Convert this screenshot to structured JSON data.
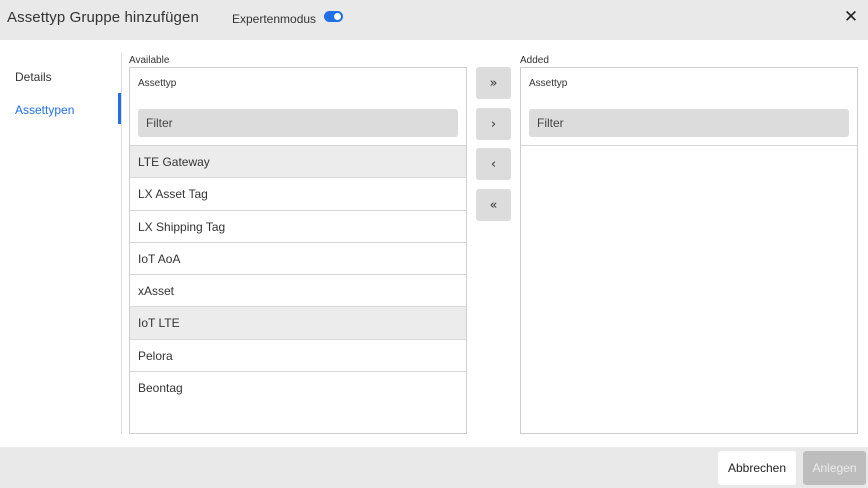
{
  "dialog": {
    "title": "Assettyp Gruppe hinzufügen",
    "expert_mode_label": "Expertenmodus",
    "expert_mode_on": true,
    "close_symbol": "✕"
  },
  "nav": {
    "items": [
      {
        "label": "Details",
        "active": false
      },
      {
        "label": "Assettypen",
        "active": true
      }
    ]
  },
  "available": {
    "label": "Available",
    "column_header": "Assettyp",
    "filter_placeholder": "Filter",
    "items": [
      {
        "label": "LTE Gateway",
        "shaded": true
      },
      {
        "label": "LX Asset Tag",
        "shaded": false
      },
      {
        "label": "LX Shipping Tag",
        "shaded": false
      },
      {
        "label": "IoT AoA",
        "shaded": false
      },
      {
        "label": "xAsset",
        "shaded": false
      },
      {
        "label": "IoT LTE",
        "shaded": true
      },
      {
        "label": "Pelora",
        "shaded": false
      },
      {
        "label": "Beontag",
        "shaded": false
      }
    ]
  },
  "added": {
    "label": "Added",
    "column_header": "Assettyp",
    "filter_placeholder": "Filter",
    "items": []
  },
  "transfer": {
    "move_all_right": "»",
    "move_right": "›",
    "move_left": "‹",
    "move_all_left": "«"
  },
  "footer": {
    "cancel_label": "Abbrechen",
    "create_label": "Anlegen",
    "create_disabled": true
  },
  "colors": {
    "accent": "#1f6fe5",
    "header_bg": "#e9e9e9",
    "button_gray": "#dcdcdc",
    "disabled_button": "#bdbdbd"
  }
}
